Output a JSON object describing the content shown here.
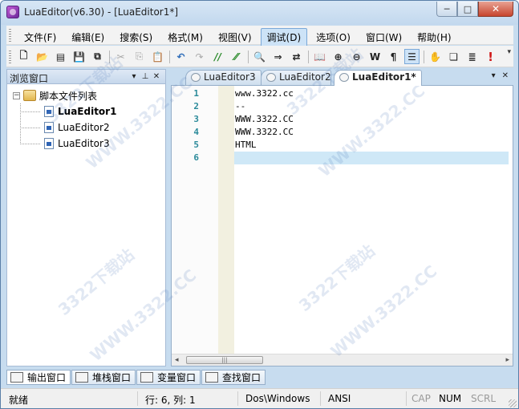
{
  "window": {
    "title": "LuaEditor(v6.30) - [LuaEditor1*]",
    "controls": {
      "minimize": "─",
      "maximize": "□",
      "close": "✕"
    }
  },
  "menu": {
    "items": [
      "文件(F)",
      "编辑(E)",
      "搜索(S)",
      "格式(M)",
      "视图(V)",
      "调试(D)",
      "选项(O)",
      "窗口(W)",
      "帮助(H)"
    ],
    "active": "调试(D)"
  },
  "toolbar": {
    "buttons": [
      {
        "name": "new-file-icon",
        "glyph": "🗋"
      },
      {
        "name": "open-folder-icon",
        "glyph": "📂"
      },
      {
        "name": "open-recent-icon",
        "glyph": "▤"
      },
      {
        "name": "save-icon",
        "glyph": "💾"
      },
      {
        "name": "save-all-icon",
        "glyph": "⧉"
      },
      {
        "name": "cut-icon",
        "glyph": "✂"
      },
      {
        "name": "copy-icon",
        "glyph": "⎘"
      },
      {
        "name": "paste-icon",
        "glyph": "📋"
      },
      {
        "name": "undo-icon",
        "glyph": "↶"
      },
      {
        "name": "redo-icon",
        "glyph": "↷"
      },
      {
        "name": "comment-icon",
        "glyph": "//"
      },
      {
        "name": "uncomment-icon",
        "glyph": "⁄⁄"
      },
      {
        "name": "find-icon",
        "glyph": "🔍"
      },
      {
        "name": "find-next-icon",
        "glyph": "⇒"
      },
      {
        "name": "replace-icon",
        "glyph": "⇄"
      },
      {
        "name": "book-icon",
        "glyph": "📖"
      },
      {
        "name": "zoom-in-icon",
        "glyph": "⊕"
      },
      {
        "name": "zoom-out-icon",
        "glyph": "⊖"
      },
      {
        "name": "word-wrap-icon",
        "glyph": "W"
      },
      {
        "name": "paragraph-icon",
        "glyph": "¶"
      },
      {
        "name": "indent-guide-icon",
        "glyph": "☰"
      },
      {
        "name": "hand-icon",
        "glyph": "✋"
      },
      {
        "name": "bookmark-icon",
        "glyph": "❏"
      },
      {
        "name": "list-icon",
        "glyph": "≣"
      },
      {
        "name": "stop-icon",
        "glyph": "!"
      }
    ],
    "more": "▾"
  },
  "browse_panel": {
    "title": "浏览窗口",
    "controls": {
      "dropdown": "▾",
      "pin": "⊥",
      "close": "✕"
    },
    "tree": {
      "root_label": "脚本文件列表",
      "expander": "−",
      "children": [
        "LuaEditor1",
        "LuaEditor2",
        "LuaEditor3"
      ],
      "selected": "LuaEditor1"
    }
  },
  "editor_tabs": {
    "tabs": [
      "LuaEditor3",
      "LuaEditor2",
      "LuaEditor1*"
    ],
    "active": "LuaEditor1*",
    "controls": {
      "dropdown": "▾",
      "close": "✕"
    }
  },
  "editor": {
    "lines": [
      {
        "num": "1",
        "code": "www.3322.cc"
      },
      {
        "num": "2",
        "code": "--"
      },
      {
        "num": "3",
        "code": "WWW.3322.CC"
      },
      {
        "num": "4",
        "code": "WWW.3322.CC"
      },
      {
        "num": "5",
        "code": "HTML"
      },
      {
        "num": "6",
        "code": ""
      }
    ],
    "current_line": 6,
    "hscroll": {
      "left": "◂",
      "right": "▸",
      "thumb": "|||"
    }
  },
  "watermark": {
    "text_a": "3322下载站",
    "text_b": "WWW.3322.CC"
  },
  "bottom_tabs": [
    "输出窗口",
    "堆栈窗口",
    "变量窗口",
    "查找窗口"
  ],
  "status": {
    "ready": "就绪",
    "position": "行: 6, 列: 1",
    "line_ending": "Dos\\Windows",
    "encoding": "ANSI",
    "cap": "CAP",
    "num": "NUM",
    "scrl": "SCRL"
  }
}
